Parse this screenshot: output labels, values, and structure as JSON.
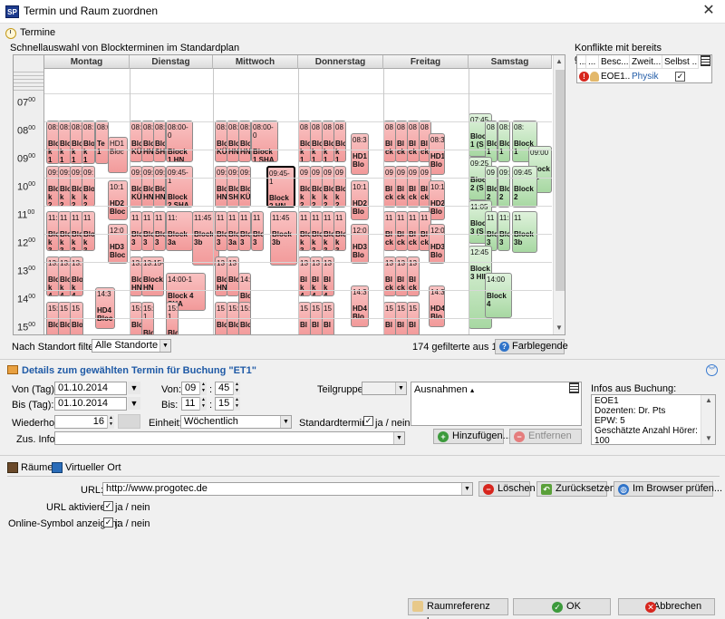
{
  "window": {
    "title": "Termin und Raum zuordnen",
    "app_icon": "SP",
    "close": "✕"
  },
  "top_tab": {
    "label": "Termine"
  },
  "schedule": {
    "label": "Schnellauswahl von Blockterminen im Standardplan",
    "days": [
      "Montag",
      "Dienstag",
      "Mittwoch",
      "Donnerstag",
      "Freitag",
      "Samstag"
    ],
    "times": [
      "07",
      "08",
      "09",
      "10",
      "11",
      "12",
      "13",
      "14",
      "15"
    ],
    "time_suffix": "00",
    "blocks": [
      {
        "t": "08:0",
        "b": "Blo k 1"
      },
      {
        "t": "08:",
        "b": "Blo k 1"
      },
      {
        "t": "08:",
        "b": "Blo k 1"
      },
      {
        "t": "08:",
        "b": "Blo k 1"
      },
      {
        "t": "08:0",
        "b": "Te 1"
      },
      {
        "t": "09:",
        "b": "Blo k 2"
      },
      {
        "t": "09:",
        "b": "Blo k 2"
      },
      {
        "t": "09:",
        "b": "Blo k 2"
      },
      {
        "t": "09:",
        "b": "Blo k 2"
      },
      {
        "t": "10:1",
        "b": "HD2 Bloc"
      },
      {
        "t": "HD1 Bloc",
        "b": ""
      },
      {
        "t": "11:",
        "b": "Blo k 3"
      },
      {
        "t": "11",
        "b": "Blo k 3"
      },
      {
        "t": "11",
        "b": "Blo k 3"
      },
      {
        "t": "11",
        "b": "Blo k 3"
      },
      {
        "t": "12:0",
        "b": "HD3 Bloc"
      },
      {
        "t": "13:",
        "b": "Blo k 4"
      },
      {
        "t": "13:",
        "b": "Blo k 4"
      },
      {
        "t": "13:",
        "b": "Blo k 4"
      },
      {
        "t": "14:3",
        "b": "HD4 Bloc"
      },
      {
        "t": "15:",
        "b": "Blo"
      },
      {
        "t": "15",
        "b": "Blo"
      },
      {
        "t": "15",
        "b": "Blo"
      },
      {
        "t": "08:",
        "b": "Bloc KÜN"
      },
      {
        "t": "08:",
        "b": "Bloc HN"
      },
      {
        "t": "08:",
        "b": "Bloc SHA"
      },
      {
        "t": "08:00-0",
        "b": "Block 1 HN"
      },
      {
        "t": "09:",
        "b": "Bloc KÜN"
      },
      {
        "t": "09:",
        "b": "Bloc HN"
      },
      {
        "t": "09:",
        "b": "Bloc HN"
      },
      {
        "t": "09:45-1",
        "b": "Block 2 SHA"
      },
      {
        "t": "11",
        "b": "Blo 3"
      },
      {
        "t": "11",
        "b": "Blo 3"
      },
      {
        "t": "11",
        "b": "Blo 3"
      },
      {
        "t": "11:",
        "b": "Block 3a"
      },
      {
        "t": "11:45",
        "b": "Block 3b"
      },
      {
        "t": "13:",
        "b": "Blo HN"
      },
      {
        "t": "13:15-",
        "b": "Block HN"
      },
      {
        "t": "14:00-1",
        "b": "Block 4 SHA"
      },
      {
        "t": "15:",
        "b": "Blo"
      },
      {
        "t": "15:00-1",
        "b": "Blo"
      },
      {
        "t": "15:45-1",
        "b": "Blo"
      },
      {
        "t": "08:",
        "b": "Blo KÜN"
      },
      {
        "t": "08:",
        "b": "Blo HN"
      },
      {
        "t": "08:",
        "b": "Blo HN"
      },
      {
        "t": "08:00-0",
        "b": "Block 1 SHA"
      },
      {
        "t": "09:",
        "b": "Blo HN"
      },
      {
        "t": "09:",
        "b": "Blo SHA"
      },
      {
        "t": "09:",
        "b": "Blo KÜN"
      },
      {
        "t": "09:45-1",
        "b": "Block 2 HN"
      },
      {
        "t": "11",
        "b": "Blo 3"
      },
      {
        "t": "11",
        "b": "Blo 3a"
      },
      {
        "t": "11",
        "b": "Blo 3"
      },
      {
        "t": "11",
        "b": "Blo 3"
      },
      {
        "t": "11:45",
        "b": "Block 3b"
      },
      {
        "t": "13",
        "b": "Blo HN"
      },
      {
        "t": "13",
        "b": "Blo"
      },
      {
        "t": "14:0",
        "b": "Blo"
      },
      {
        "t": "15",
        "b": "Blo"
      },
      {
        "t": "15:00",
        "b": "Blo"
      },
      {
        "t": "15:4",
        "b": "Blo"
      },
      {
        "t": "08",
        "b": "Blo k 1"
      },
      {
        "t": "08",
        "b": "Blo k 1"
      },
      {
        "t": "08",
        "b": "Blo k 1"
      },
      {
        "t": "08",
        "b": "Blo k 1"
      },
      {
        "t": "08:3",
        "b": "HD1 Blo"
      },
      {
        "t": "09",
        "b": "Blo k 2"
      },
      {
        "t": "09",
        "b": "Blo k 2"
      },
      {
        "t": "09",
        "b": "Blo k 2"
      },
      {
        "t": "09",
        "b": "Blo k 2"
      },
      {
        "t": "10:1",
        "b": "HD2 Blo"
      },
      {
        "t": "11",
        "b": "Blo k 3"
      },
      {
        "t": "11",
        "b": "Blo k 3"
      },
      {
        "t": "11",
        "b": "Blo k 3"
      },
      {
        "t": "11",
        "b": "Blo k 3"
      },
      {
        "t": "12:0",
        "b": "HD3 Blo"
      },
      {
        "t": "13",
        "b": "Bl k 4"
      },
      {
        "t": "13",
        "b": "Bl k 4"
      },
      {
        "t": "13",
        "b": "Bl k 4"
      },
      {
        "t": "14:3",
        "b": "HD4 Blo"
      },
      {
        "t": "15",
        "b": "Bl"
      },
      {
        "t": "15",
        "b": "Bl"
      },
      {
        "t": "15",
        "b": "Bl"
      },
      {
        "t": "08",
        "b": "Bl ck"
      },
      {
        "t": "08",
        "b": "Bl ck"
      },
      {
        "t": "08",
        "b": "Bl ck"
      },
      {
        "t": "08",
        "b": "Bl ck"
      },
      {
        "t": "08:3",
        "b": "HD1 Blo"
      },
      {
        "t": "09",
        "b": "Bl ck"
      },
      {
        "t": "09",
        "b": "Bl ck"
      },
      {
        "t": "09",
        "b": "Bl ck"
      },
      {
        "t": "09",
        "b": "Bl ck"
      },
      {
        "t": "10:1",
        "b": "HD2 Blo"
      },
      {
        "t": "11",
        "b": "Bl ck"
      },
      {
        "t": "11",
        "b": "Bl ck"
      },
      {
        "t": "11",
        "b": "Bl ck"
      },
      {
        "t": "11",
        "b": "Bl ck"
      },
      {
        "t": "12:0",
        "b": "HD3 Blo"
      },
      {
        "t": "13",
        "b": "Bl ck"
      },
      {
        "t": "13",
        "b": "Bl ck"
      },
      {
        "t": "13",
        "b": "Bl ck"
      },
      {
        "t": "14:3",
        "b": "HD4 Blo"
      },
      {
        "t": "15",
        "b": "Bl"
      },
      {
        "t": "15",
        "b": "Bl"
      },
      {
        "t": "15",
        "b": "Bl"
      },
      {
        "t": "07:45",
        "b": "Block 1 (S"
      },
      {
        "t": "08",
        "b": "Blo 1"
      },
      {
        "t": "08:",
        "b": "Blo 1"
      },
      {
        "t": "08:",
        "b": "Block 1"
      },
      {
        "t": "09:00",
        "b": "Block LL"
      },
      {
        "t": "09:25",
        "b": "Block 2 (S"
      },
      {
        "t": "09",
        "b": "Blo 2"
      },
      {
        "t": "09:",
        "b": "Blo 2"
      },
      {
        "t": "09:45",
        "b": "Block 2"
      },
      {
        "t": "11:05",
        "b": "Block 3 (S"
      },
      {
        "t": "11",
        "b": "Blo 3"
      },
      {
        "t": "11:30",
        "b": "Blo 3"
      },
      {
        "t": "11",
        "b": "Block 3b"
      },
      {
        "t": "12:45",
        "b": "Block 3 HIL"
      },
      {
        "t": "14:00",
        "b": "Block 4"
      }
    ]
  },
  "filter": {
    "label": "Nach Standort filtern:",
    "value": "Alle Standorte",
    "count_text": "174 gefilterte aus 174",
    "legend_btn": "Farblegende"
  },
  "conflicts": {
    "label": "Konflikte mit bereits gespeicherten B...",
    "headers": [
      "...",
      "...",
      "Besc...",
      "Zweit...",
      "Selbst ..."
    ],
    "row": {
      "desc": "EOE1...",
      "secondary": "Physik",
      "check": "✓"
    }
  },
  "details": {
    "title": "Details zum gewählten Termin für Buchung \"ET1\"",
    "von_tag_label": "Von (Tag):",
    "von_tag": "01.10.2014",
    "bis_tag_label": "Bis (Tag):",
    "bis_tag": "01.10.2014",
    "von_label": "Von:",
    "von_h": "09",
    "von_m": "45",
    "bis_label": "Bis:",
    "bis_h": "11",
    "bis_m": "15",
    "time_sep": ":",
    "teilgruppe_label": "Teilgruppe:",
    "wiederhol_label": "Wiederhol.:",
    "wiederhol_value": "16",
    "einheit_label": "Einheit:",
    "einheit_value": "Wöchentlich",
    "standardtermin_label": "Standardtermin:",
    "standardtermin_value": "ja / nein",
    "zusinfo_label": "Zus. Info:",
    "ausnahmen_label": "Ausnahmen",
    "hinzufuegen": "Hinzufügen...",
    "entfernen": "Entfernen",
    "info_label": "Infos aus Buchung:",
    "info_lines": [
      "EOE1",
      "Dozenten: Dr. Pts",
      "EPW: 5",
      "Geschätzte Anzahl Hörer: 100"
    ]
  },
  "location": {
    "tab_raeume": "Räume",
    "tab_virtuell": "Virtueller Ort",
    "url_label": "URL:",
    "url_value": "http://www.progotec.de",
    "loeschen": "Löschen",
    "zuruecksetzen": "Zurücksetzen",
    "browser": "Im Browser prüfen...",
    "url_aktivieren_label": "URL aktivieren:",
    "url_aktivieren_value": "ja / nein",
    "online_label": "Online-Symbol anzeigen:",
    "online_value": "ja / nein"
  },
  "footer": {
    "raumref": "Raumreferenz leeren",
    "ok": "OK",
    "abbrechen": "Abbrechen"
  },
  "colors": {
    "red_block": "#f29a9a",
    "green_block": "#a7d8a2",
    "accent": "#1f5aa6"
  }
}
